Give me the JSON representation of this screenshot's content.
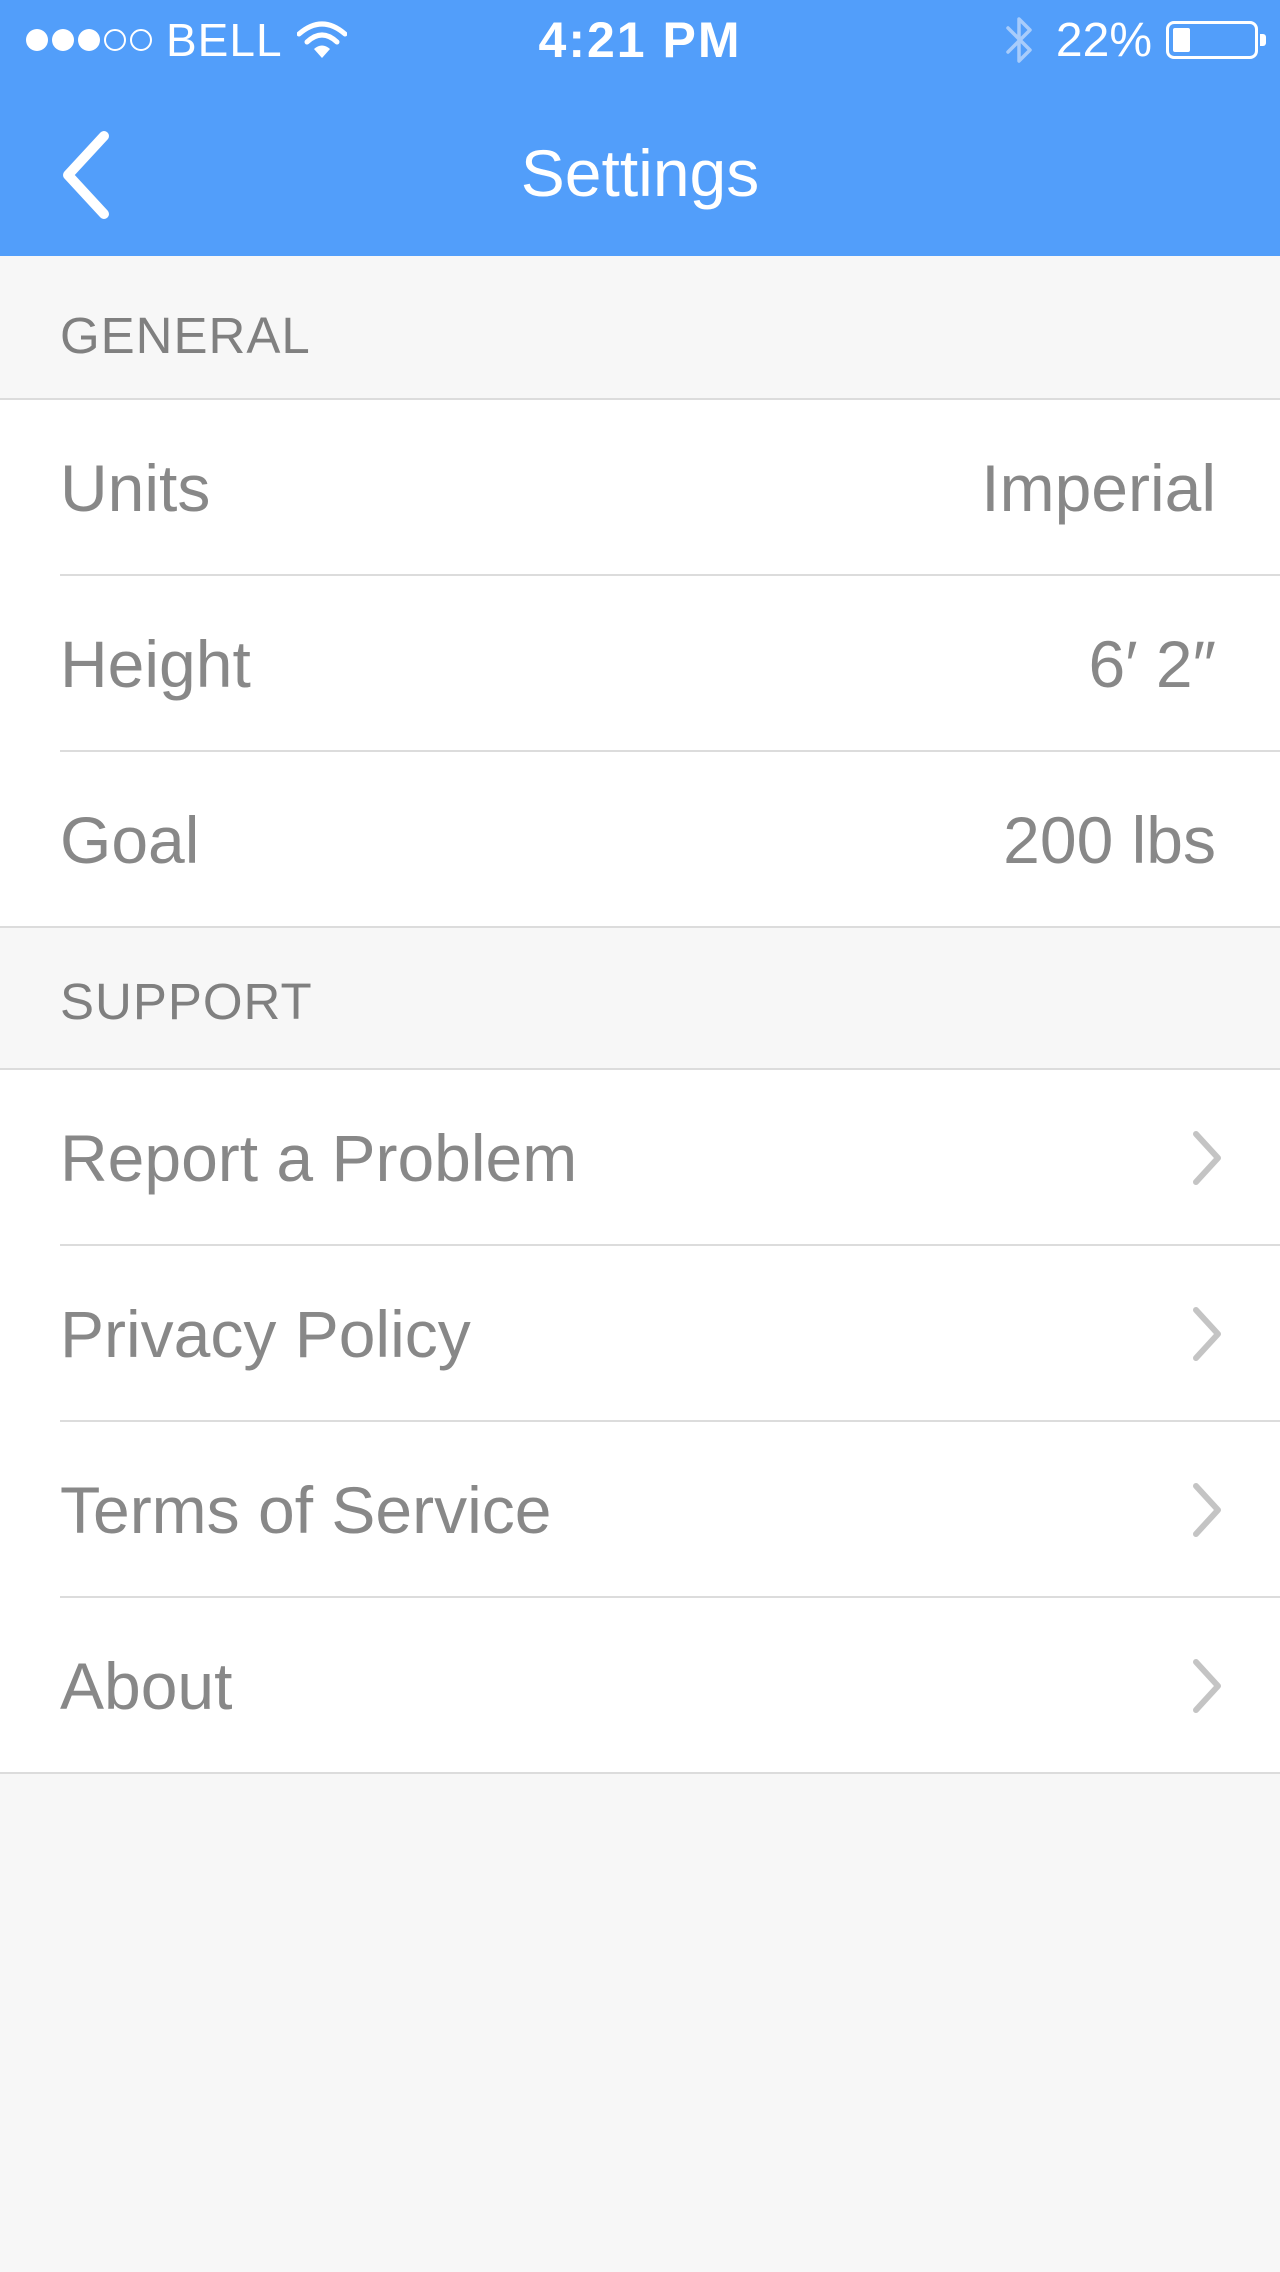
{
  "status_bar": {
    "signal_full": 3,
    "signal_total": 5,
    "carrier": "BELL",
    "time": "4:21 PM",
    "battery_percent": "22%",
    "battery_level": 0.22,
    "icons": [
      "signal-dots-icon",
      "wifi-icon",
      "bluetooth-icon",
      "battery-icon"
    ]
  },
  "nav": {
    "title": "Settings",
    "back_icon": "chevron-left-icon",
    "color": "#529efa"
  },
  "general": {
    "header": "GENERAL",
    "rows": [
      {
        "label": "Units",
        "value": "Imperial"
      },
      {
        "label": "Height",
        "value": "6′ 2″"
      },
      {
        "label": "Goal",
        "value": "200 lbs"
      }
    ]
  },
  "support": {
    "header": "SUPPORT",
    "rows": [
      {
        "label": "Report a Problem",
        "icon": "chevron-right-icon"
      },
      {
        "label": "Privacy Policy",
        "icon": "chevron-right-icon"
      },
      {
        "label": "Terms of Service",
        "icon": "chevron-right-icon"
      },
      {
        "label": "About",
        "icon": "chevron-right-icon"
      }
    ]
  }
}
